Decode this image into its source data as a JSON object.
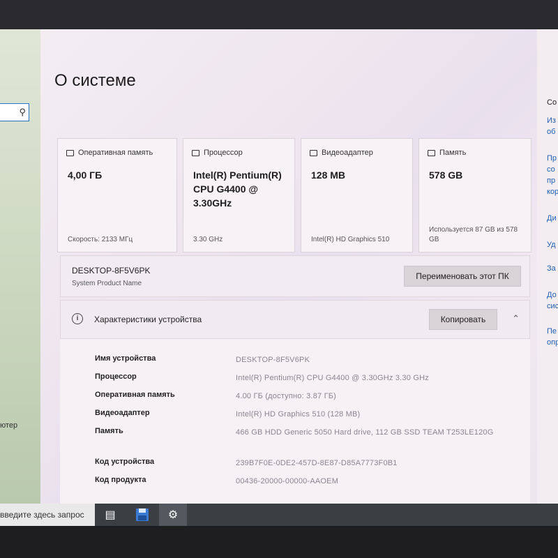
{
  "sidebar": {
    "fragment": "ютер"
  },
  "page": {
    "title": "О системе"
  },
  "cards": [
    {
      "label": "Оперативная память",
      "value": "4,00 ГБ",
      "sub": "Скорость: 2133 МГц",
      "icon": "memory-icon"
    },
    {
      "label": "Процессор",
      "value": "Intel(R) Pentium(R) CPU G4400 @ 3.30GHz",
      "sub": "3.30 GHz",
      "icon": "processor-icon"
    },
    {
      "label": "Видеоадаптер",
      "value": "128 MB",
      "sub": "Intel(R) HD Graphics 510",
      "icon": "display-adapter-icon"
    },
    {
      "label": "Память",
      "value": "578 GB",
      "sub": "Используется 87 GB из 578 GB",
      "icon": "storage-icon"
    }
  ],
  "device": {
    "name": "DESKTOP-8F5V6PK",
    "sublabel": "System Product Name",
    "rename_label": "Переименовать этот ПК"
  },
  "specs": {
    "title": "Характеристики устройства",
    "copy_label": "Копировать",
    "rows": [
      {
        "key": "Имя устройства",
        "value": "DESKTOP-8F5V6PK"
      },
      {
        "key": "Процессор",
        "value": "Intel(R) Pentium(R) CPU G4400 @ 3.30GHz   3.30 GHz"
      },
      {
        "key": "Оперативная память",
        "value": "4.00 ГБ (доступно: 3.87 ГБ)"
      },
      {
        "key": "Видеоадаптер",
        "value": "Intel(R) HD Graphics 510 (128 MB)"
      },
      {
        "key": "Память",
        "value": "466 GB HDD Generic 5050 Hard drive, 112 GB SSD TEAM T253LE120G"
      },
      {
        "key": "Код устройства",
        "value": "239B7F0E-0DE2-457D-8E87-D85A7773F0B1"
      },
      {
        "key": "Код продукта",
        "value": "00436-20000-00000-AAOEM"
      }
    ]
  },
  "right_links": [
    "Со",
    "Из",
    "об",
    "Пр",
    "со",
    "пр",
    "кор",
    "Ди",
    "Уд",
    "За",
    "До",
    "сис",
    "Пе",
    "опр"
  ],
  "taskbar": {
    "search_placeholder": "введите здесь запрос"
  }
}
